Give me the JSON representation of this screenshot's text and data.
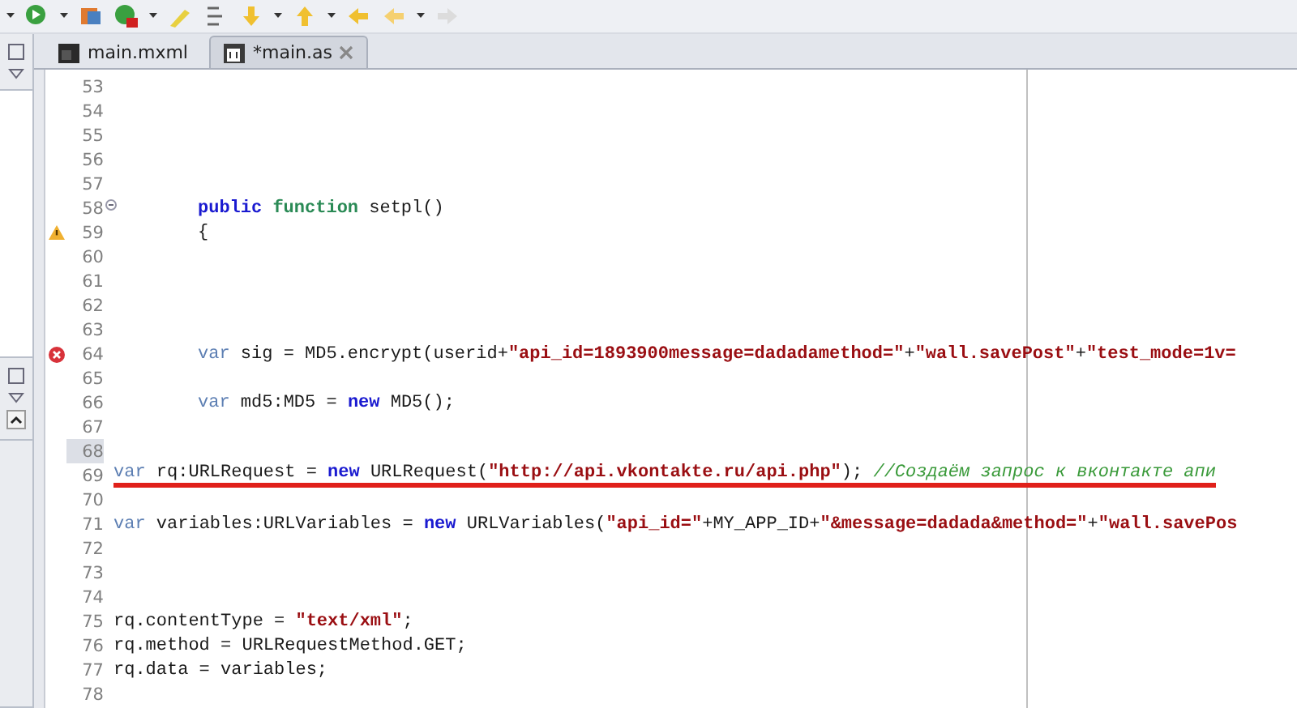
{
  "tabs": [
    {
      "label": "main.mxml",
      "kind": "mxml",
      "selected": false,
      "closable": false
    },
    {
      "label": "*main.as",
      "kind": "as",
      "selected": true,
      "closable": true
    }
  ],
  "editor": {
    "lines": [
      {
        "number": "53",
        "current": false
      },
      {
        "number": "54",
        "current": false
      },
      {
        "number": "55",
        "current": false
      },
      {
        "number": "56",
        "current": false
      },
      {
        "number": "57",
        "current": false
      },
      {
        "number": "58",
        "current": false,
        "foldable": true,
        "indented": true,
        "segments": [
          {
            "kind": "keyword",
            "text": "public"
          },
          {
            "kind": "function",
            "text": " function"
          },
          {
            "kind": "plain",
            "text": " setpl()"
          }
        ]
      },
      {
        "number": "59",
        "current": false,
        "warning": true,
        "indented": true,
        "segments": [
          {
            "kind": "plain",
            "text": "{"
          }
        ]
      },
      {
        "number": "60",
        "current": false
      },
      {
        "number": "61",
        "current": false
      },
      {
        "number": "62",
        "current": false
      },
      {
        "number": "63",
        "current": false
      },
      {
        "number": "64",
        "current": false,
        "error": true,
        "indented": true,
        "segments": [
          {
            "kind": "var",
            "text": "var"
          },
          {
            "kind": "plain",
            "text": " sig = MD5.encrypt(userid+"
          },
          {
            "kind": "string",
            "text": "\"api_id=1893900message=dadadamethod=\""
          },
          {
            "kind": "plain",
            "text": "+"
          },
          {
            "kind": "string",
            "text": "\"wall.savePost\""
          },
          {
            "kind": "plain",
            "text": "+"
          },
          {
            "kind": "string",
            "text": "\"test_mode=1v="
          }
        ]
      },
      {
        "number": "65",
        "current": false
      },
      {
        "number": "66",
        "current": false,
        "indented": true,
        "segments": [
          {
            "kind": "var",
            "text": "var"
          },
          {
            "kind": "plain",
            "text": " md5:MD5 = "
          },
          {
            "kind": "keyword",
            "text": "new"
          },
          {
            "kind": "plain",
            "text": " MD5();"
          }
        ]
      },
      {
        "number": "67",
        "current": false
      },
      {
        "number": "68",
        "current": true
      },
      {
        "number": "69",
        "current": false,
        "indented": false,
        "underlined": true,
        "segments": [
          {
            "kind": "var",
            "text": "var"
          },
          {
            "kind": "plain",
            "text": " rq:URLRequest = "
          },
          {
            "kind": "keyword",
            "text": "new"
          },
          {
            "kind": "plain",
            "text": " URLRequest("
          },
          {
            "kind": "string",
            "text": "\"http://api.vkontakte.ru/api.php\""
          },
          {
            "kind": "plain",
            "text": "); "
          },
          {
            "kind": "comment",
            "text": "//Создаём запрос к вконтакте апи"
          }
        ]
      },
      {
        "number": "70",
        "current": false
      },
      {
        "number": "71",
        "current": false,
        "indented": false,
        "segments": [
          {
            "kind": "var",
            "text": "var"
          },
          {
            "kind": "plain",
            "text": " variables:URLVariables = "
          },
          {
            "kind": "keyword",
            "text": "new"
          },
          {
            "kind": "plain",
            "text": " URLVariables("
          },
          {
            "kind": "string",
            "text": "\"api_id=\""
          },
          {
            "kind": "plain",
            "text": "+MY_APP_ID+"
          },
          {
            "kind": "string",
            "text": "\"&message=dadada&method=\""
          },
          {
            "kind": "plain",
            "text": "+"
          },
          {
            "kind": "string",
            "text": "\"wall.savePos"
          }
        ]
      },
      {
        "number": "72",
        "current": false
      },
      {
        "number": "73",
        "current": false
      },
      {
        "number": "74",
        "current": false
      },
      {
        "number": "75",
        "current": false,
        "indented": false,
        "segments": [
          {
            "kind": "plain",
            "text": "rq.contentType = "
          },
          {
            "kind": "string",
            "text": "\"text/xml\""
          },
          {
            "kind": "plain",
            "text": ";"
          }
        ]
      },
      {
        "number": "76",
        "current": false,
        "indented": false,
        "segments": [
          {
            "kind": "plain",
            "text": "rq.method = URLRequestMethod.GET;"
          }
        ]
      },
      {
        "number": "77",
        "current": false,
        "indented": false,
        "segments": [
          {
            "kind": "plain",
            "text": "rq.data = variables;"
          }
        ]
      },
      {
        "number": "78",
        "current": false
      }
    ]
  }
}
